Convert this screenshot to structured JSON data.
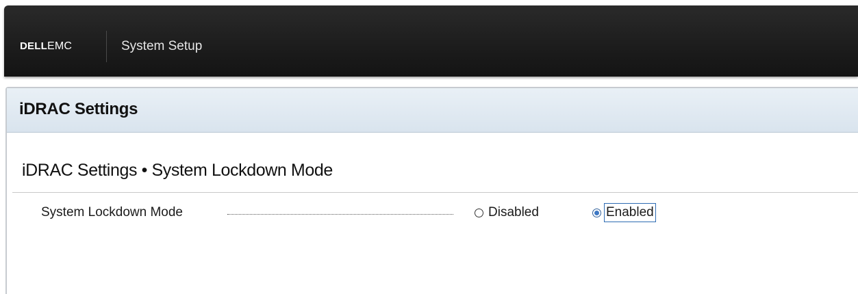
{
  "header": {
    "brand_dell": "DELL",
    "brand_emc": "EMC",
    "app_title": "System Setup"
  },
  "panel": {
    "title": "iDRAC Settings",
    "breadcrumb": "iDRAC Settings • System Lockdown Mode"
  },
  "setting": {
    "label": "System Lockdown Mode",
    "options": [
      {
        "label": "Disabled",
        "selected": false
      },
      {
        "label": "Enabled",
        "selected": true
      }
    ]
  },
  "colors": {
    "header_bg": "#1c1c1c",
    "panel_header_bg": "#dfe8f0",
    "radio_selected": "#3d78c4",
    "focus_outline": "#2d6bb3"
  },
  "icons": {
    "radio_unselected": "radio-unchecked-icon",
    "radio_selected": "radio-checked-icon"
  }
}
